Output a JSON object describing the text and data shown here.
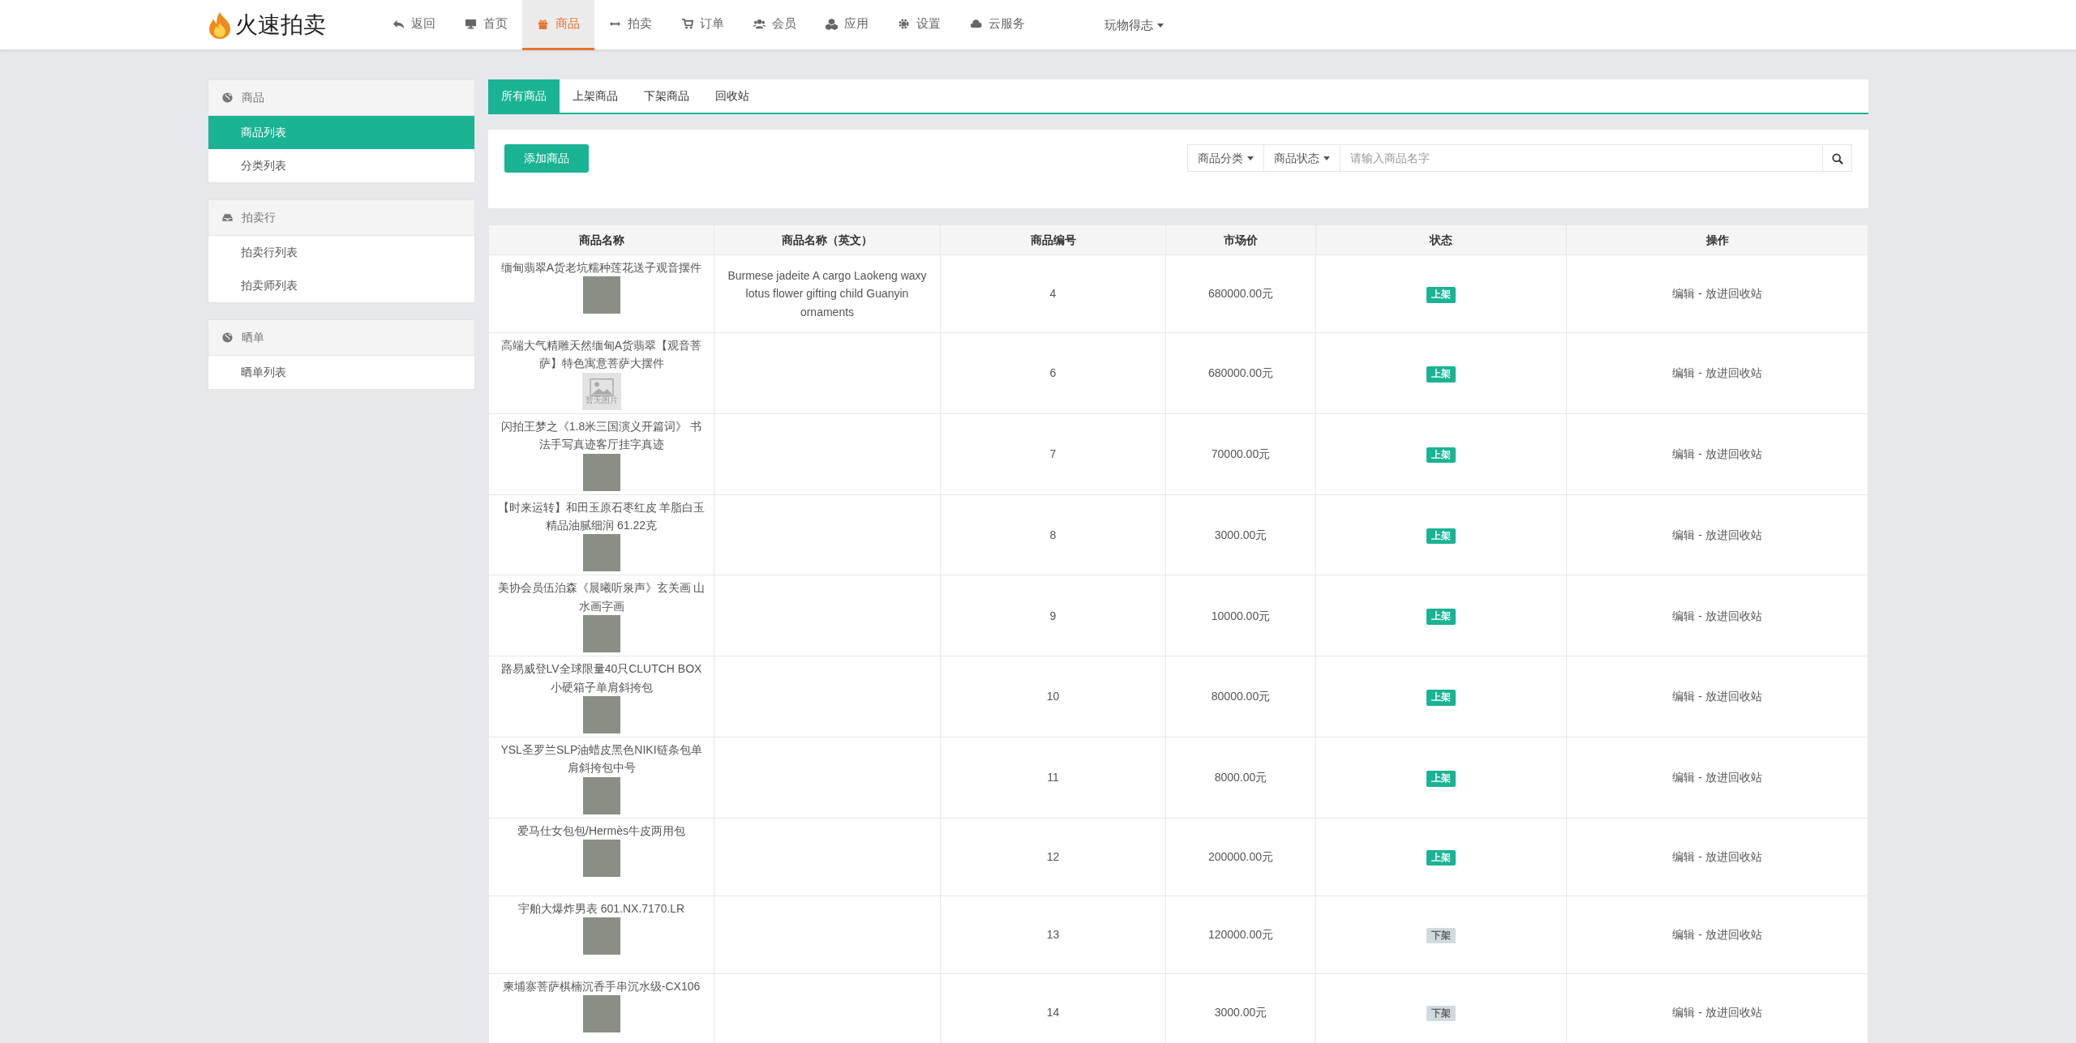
{
  "brand": "火速拍卖",
  "nav": [
    {
      "label": "返回",
      "selected": false
    },
    {
      "label": "首页",
      "selected": false
    },
    {
      "label": "商品",
      "selected": true
    },
    {
      "label": "拍卖",
      "selected": false
    },
    {
      "label": "订单",
      "selected": false
    },
    {
      "label": "会员",
      "selected": false
    },
    {
      "label": "应用",
      "selected": false
    },
    {
      "label": "设置",
      "selected": false
    },
    {
      "label": "云服务",
      "selected": false
    }
  ],
  "user": "玩物得志",
  "sidebar": [
    {
      "title": "商品",
      "items": [
        {
          "label": "商品列表",
          "selected": true
        },
        {
          "label": "分类列表",
          "selected": false
        }
      ]
    },
    {
      "title": "拍卖行",
      "items": [
        {
          "label": "拍卖行列表",
          "selected": false
        },
        {
          "label": "拍卖师列表",
          "selected": false
        }
      ]
    },
    {
      "title": "晒单",
      "items": [
        {
          "label": "晒单列表",
          "selected": false
        }
      ]
    }
  ],
  "tabs": [
    {
      "label": "所有商品",
      "selected": true
    },
    {
      "label": "上架商品",
      "selected": false
    },
    {
      "label": "下架商品",
      "selected": false
    },
    {
      "label": "回收站",
      "selected": false
    }
  ],
  "toolbar": {
    "add_button": "添加商品",
    "filters": [
      "商品分类",
      "商品状态"
    ],
    "search": {
      "placeholder": "请输入商品名字"
    }
  },
  "table": {
    "columns": [
      "商品名称",
      "商品名称（英文）",
      "商品编号",
      "市场价",
      "状态",
      "操作"
    ],
    "rows": [
      {
        "name": "缅甸翡翠A货老坑糯种莲花送子观音摆件",
        "name_en": "Burmese jadeite A cargo Laokeng waxy lotus flower gifting child Guanyin ornaments",
        "number": "4",
        "price": "680000.00元",
        "status": "上架",
        "listed": true,
        "actions": {
          "edit": "编辑",
          "separator": "-",
          "recycle": "放进回收站"
        }
      },
      {
        "name": "高端大气精雕天然缅甸A货翡翠【观音菩萨】特色寓意菩萨大摆件",
        "no_image_label": "暂无图片",
        "number": "6",
        "price": "680000.00元",
        "status": "上架",
        "listed": true,
        "actions": {
          "edit": "编辑",
          "separator": "-",
          "recycle": "放进回收站"
        }
      },
      {
        "name": "闪拍王梦之《1.8米三国演义开篇词》 书法手写真迹客厅挂字真迹",
        "number": "7",
        "price": "70000.00元",
        "status": "上架",
        "listed": true,
        "actions": {
          "edit": "编辑",
          "separator": "-",
          "recycle": "放进回收站"
        }
      },
      {
        "name": "【时来运转】和田玉原石枣红皮 羊脂白玉精品油腻细润 61.22克",
        "number": "8",
        "price": "3000.00元",
        "status": "上架",
        "listed": true,
        "actions": {
          "edit": "编辑",
          "separator": "-",
          "recycle": "放进回收站"
        }
      },
      {
        "name": "美协会员伍泊森《晨曦听泉声》玄关画 山水画字画",
        "number": "9",
        "price": "10000.00元",
        "status": "上架",
        "listed": true,
        "actions": {
          "edit": "编辑",
          "separator": "-",
          "recycle": "放进回收站"
        }
      },
      {
        "name": "路易威登LV全球限量40只CLUTCH BOX小硬箱子单肩斜挎包",
        "number": "10",
        "price": "80000.00元",
        "status": "上架",
        "listed": true,
        "actions": {
          "edit": "编辑",
          "separator": "-",
          "recycle": "放进回收站"
        }
      },
      {
        "name": "YSL圣罗兰SLP油蜡皮黑色NIKI链条包单肩斜挎包中号",
        "number": "11",
        "price": "8000.00元",
        "status": "上架",
        "listed": true,
        "actions": {
          "edit": "编辑",
          "separator": "-",
          "recycle": "放进回收站"
        }
      },
      {
        "name": "爱马仕女包包/Hermès牛皮两用包",
        "number": "12",
        "price": "200000.00元",
        "status": "上架",
        "listed": true,
        "actions": {
          "edit": "编辑",
          "separator": "-",
          "recycle": "放进回收站"
        }
      },
      {
        "name": "宇舶大爆炸男表 601.NX.7170.LR",
        "number": "13",
        "price": "120000.00元",
        "status": "下架",
        "listed": false,
        "actions": {
          "edit": "编辑",
          "separator": "-",
          "recycle": "放进回收站"
        }
      },
      {
        "name": "柬埔寨菩萨棋楠沉香手串沉水级-CX106",
        "number": "14",
        "price": "3000.00元",
        "status": "下架",
        "listed": false,
        "actions": {
          "edit": "编辑",
          "separator": "-",
          "recycle": "放进回收站"
        }
      }
    ]
  }
}
